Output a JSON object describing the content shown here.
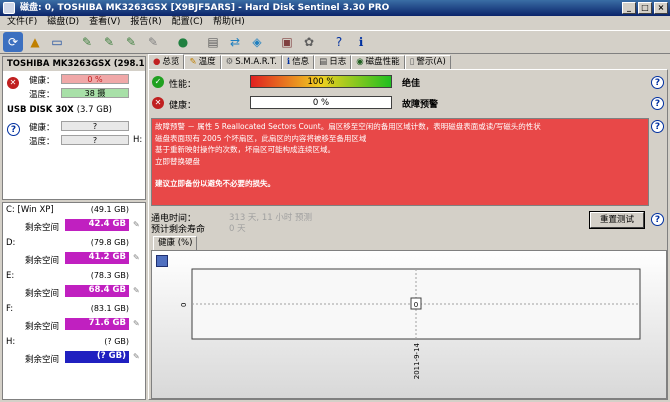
{
  "window": {
    "title": "磁盘: 0, TOSHIBA MK3263GSX [X9BJF5ARS] - Hard Disk Sentinel 3.30 PRO",
    "buttons": [
      "_",
      "□",
      "×"
    ]
  },
  "menu": [
    "文件(F)",
    "磁盘(D)",
    "查看(V)",
    "报告(R)",
    "配置(C)",
    "帮助(H)"
  ],
  "disks": [
    {
      "name": "TOSHIBA MK3263GSX",
      "size": "(298.1 GB",
      "health_label": "健康：",
      "health_value": "0 %",
      "temp_label": "温度：",
      "temp_value": "38 摄",
      "status_icon": "error-icon"
    },
    {
      "name": "USB DISK 30X",
      "size": "(3.7 GB)",
      "health_label": "健康：",
      "health_value": "?",
      "temp_label": "温度：",
      "temp_value": "?",
      "extra": "H:",
      "status_icon": "help-icon"
    }
  ],
  "volumes": [
    {
      "name": "C: [Win XP]",
      "size": "(49.1 GB)",
      "free_label": "剩余空间",
      "free": "42.4 GB",
      "color": "#c020c0",
      "fill": 1.0
    },
    {
      "name": "D:",
      "size": "(79.8 GB)",
      "free_label": "剩余空间",
      "free": "41.2 GB",
      "color": "#c020c0",
      "fill": 1.0
    },
    {
      "name": "E:",
      "size": "(78.3 GB)",
      "free_label": "剩余空间",
      "free": "68.4 GB",
      "color": "#c020c0",
      "fill": 1.0
    },
    {
      "name": "F:",
      "size": "(83.1 GB)",
      "free_label": "剩余空间",
      "free": "71.6 GB",
      "color": "#c020c0",
      "fill": 1.0
    },
    {
      "name": "H:",
      "size": "(? GB)",
      "free_label": "剩余空间",
      "free": "(? GB)",
      "color": "#2020c0",
      "fill": 1.0
    }
  ],
  "tabs": [
    "总览",
    "温度",
    "S.M.A.R.T.",
    "信息",
    "日志",
    "磁盘性能",
    "警示(A)"
  ],
  "performance": {
    "label": "性能：",
    "value": "100 %",
    "word": "绝佳",
    "fill": 1.0
  },
  "health": {
    "label": "健康：",
    "value": "0 %",
    "word": "故障预警",
    "fill": 0.0
  },
  "alert_lines": [
    "故障预警 － 属性 5 Reallocated Sectors Count。扇区移至空闲的备用区域计数，表明磁盘表面或读/写磁头的性状",
    "磁盘表面现有 2005 个坏扇区，此扇区的内容将被移至备用区域",
    "基于重新映射操作的次数，坏扇区可能构成连续区域。",
    "立即替换硬盘",
    "",
    "建议立即备份以避免不必要的损失。"
  ],
  "power_on": {
    "label": "通电时间：",
    "value": "313 天, 11 小时 预测"
  },
  "remaining": {
    "label": "预计剩余寿命",
    "value": "0 天"
  },
  "reset_button": "重置测试",
  "chart_tab": "健康 (%)",
  "chart_data": {
    "type": "line",
    "x": [
      "2011-9-14"
    ],
    "values": [
      0
    ],
    "ytick": "0",
    "xtick": "2011-9-14",
    "point_label": "0"
  }
}
